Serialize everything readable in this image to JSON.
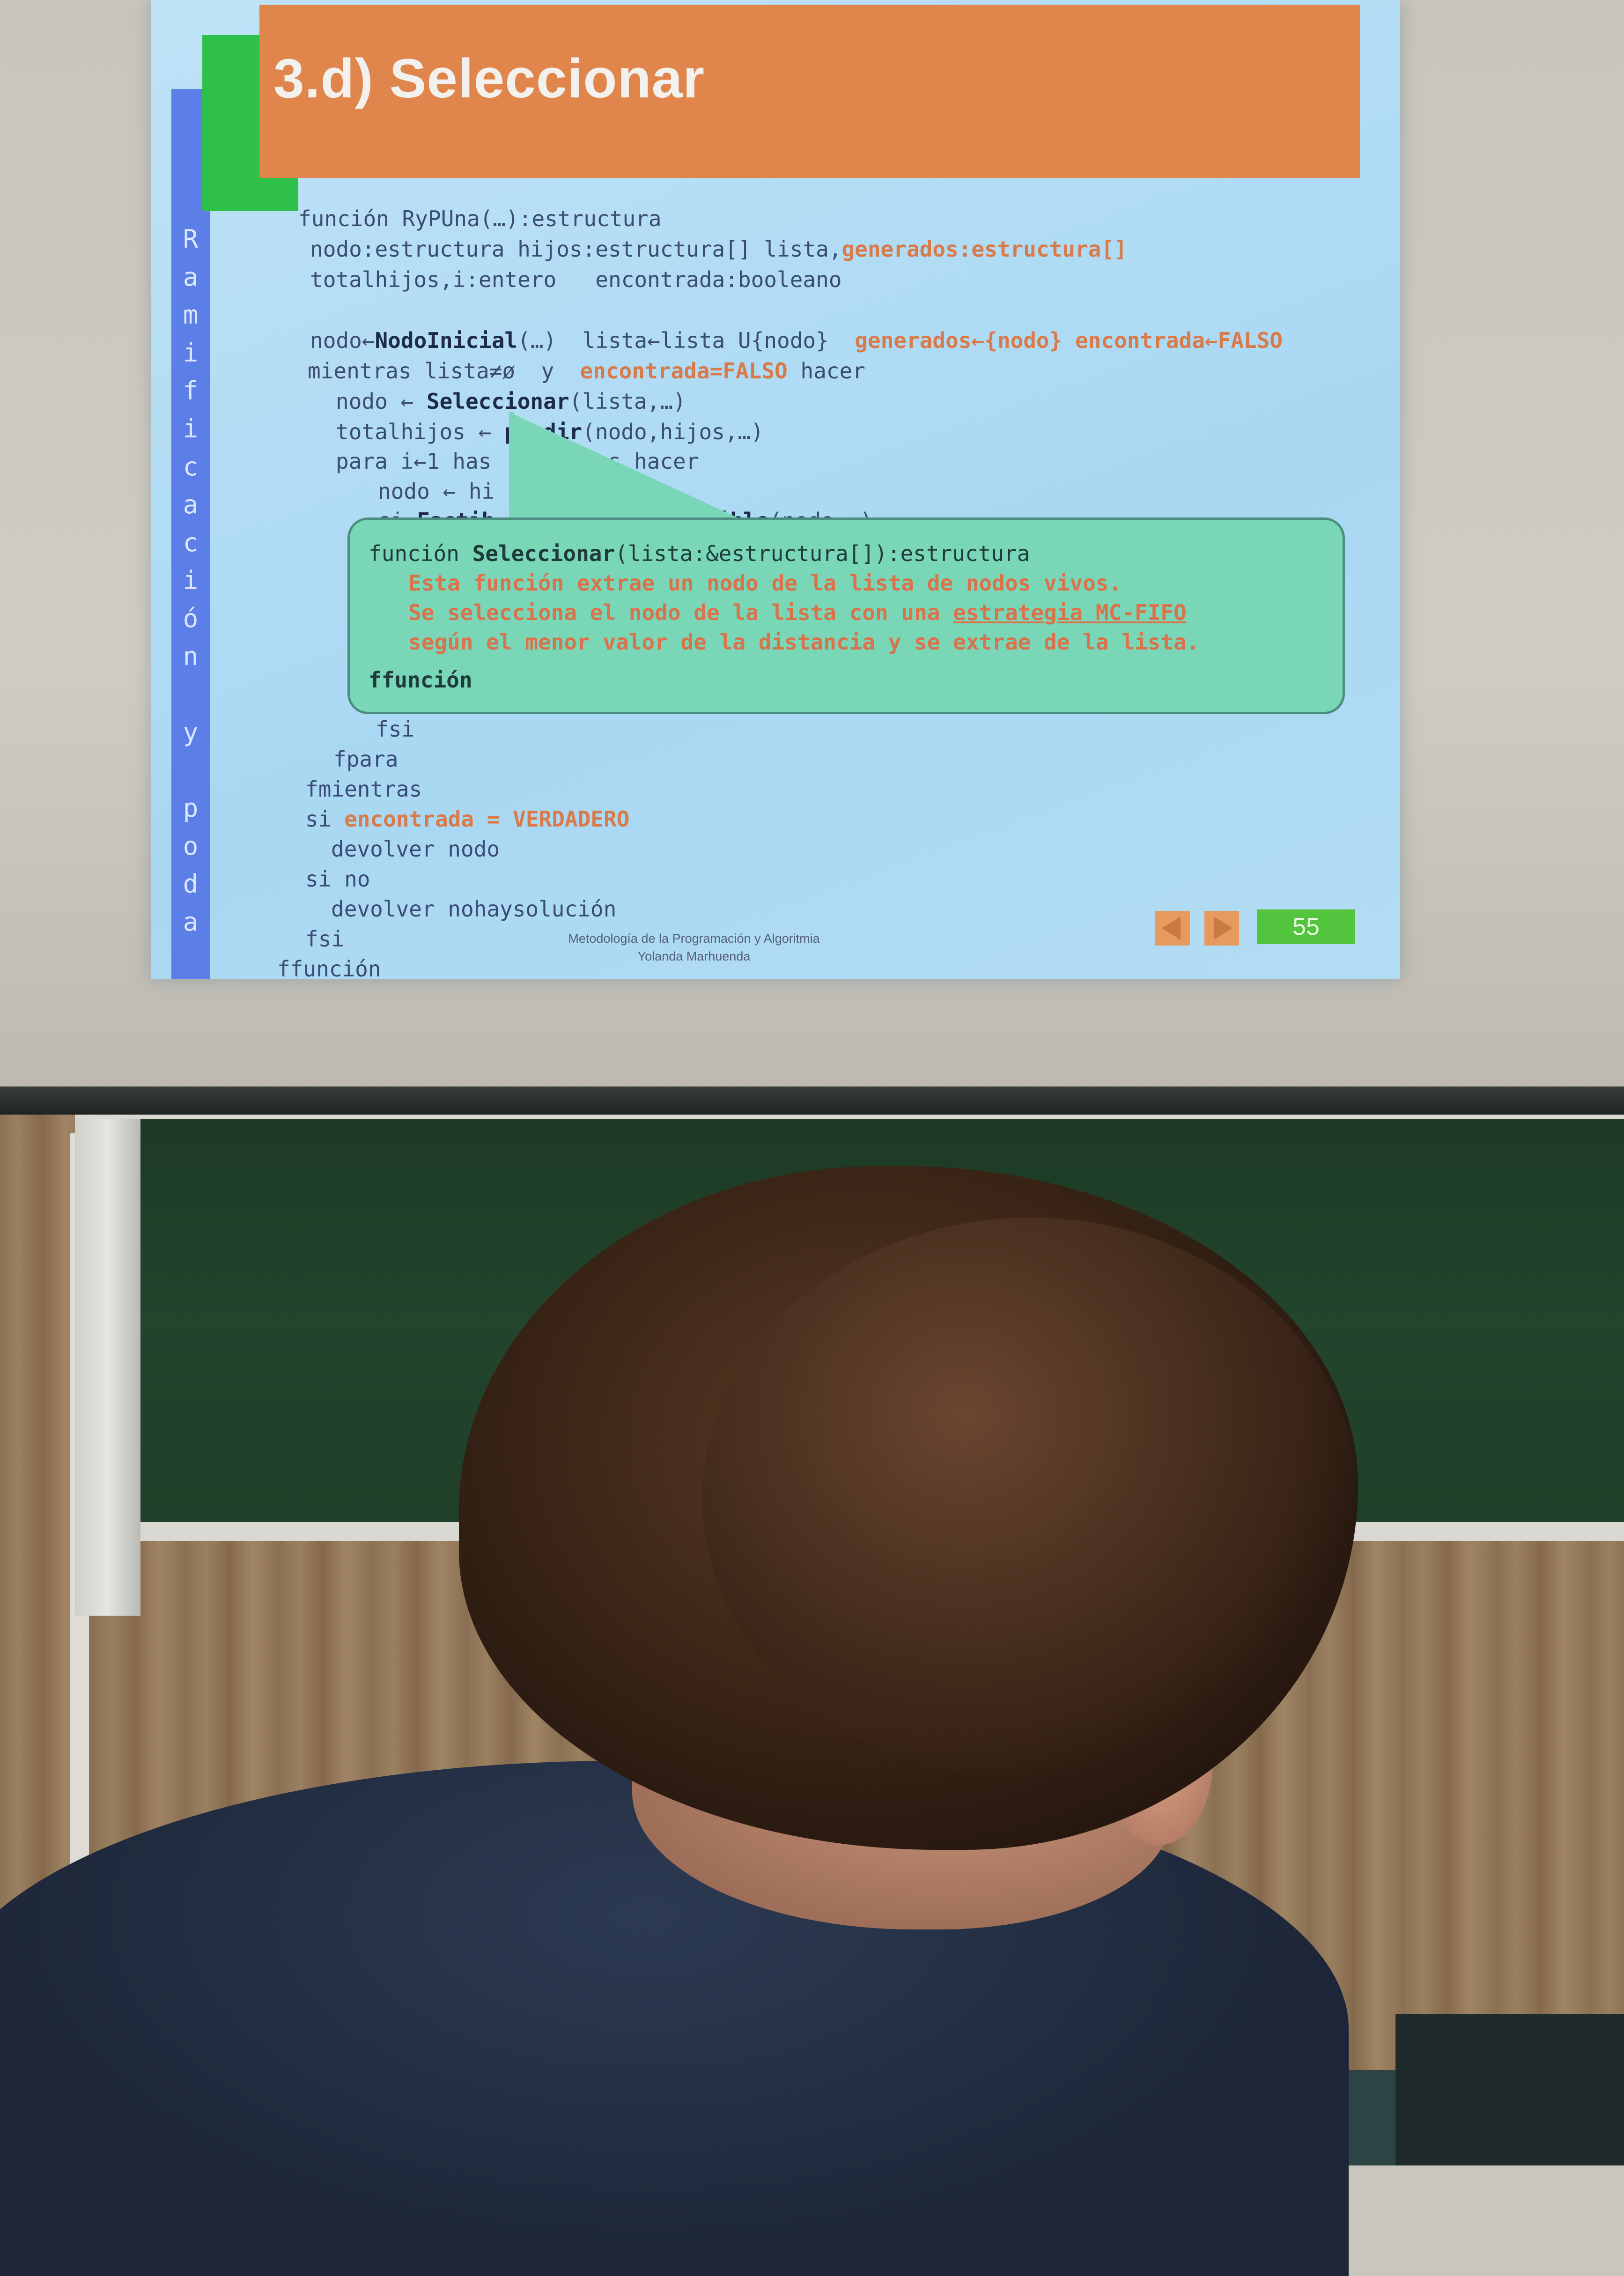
{
  "slide": {
    "title": "3.d) Seleccionar",
    "side_vertical_text": "R\na\nm\ni\nf\ni\nc\na\nc\ni\nó\nn\n\ny\n\np\no\nd\na",
    "code": {
      "l1": "función RyPUna(…):estructura",
      "l2a": "nodo:estructura hijos:estructura[] lista,",
      "l2b": "generados:estructura[]",
      "l3": "totalhijos,i:entero   encontrada:booleano",
      "l4a": "nodo←",
      "l4b": "NodoInicial",
      "l4c": "(…)  lista←lista U{nodo}  ",
      "l4d": "generados←{nodo} encontrada←FALSO",
      "l5a": "mientras lista≠ø  y  ",
      "l5b": "encontrada=FALSO",
      "l5c": " hacer",
      "l6a": "nodo ← ",
      "l6b": "Seleccionar",
      "l6c": "(lista,…)",
      "l7a": "totalhijos ← ",
      "l7b": "pandir",
      "l7c": "(nodo,hijos,…)",
      "l8": "para i←1 has    lhijos hacer",
      "l9": "nodo ← hi",
      "l10a": "si ",
      "l10b": "Factib",
      "l10c": "isible",
      "l10d": "(nodo,…)",
      "l11": "fsi",
      "l12": "fpara",
      "l13": "fmientras",
      "l14a": "si ",
      "l14b": "encontrada = VERDADERO",
      "l15": "devolver nodo",
      "l16": "si no",
      "l17": "devolver nohaysolución",
      "l18": "fsi",
      "l19": "ffunción"
    },
    "callout": {
      "c1a": "función ",
      "c1b": "Seleccionar",
      "c1c": "(lista:&estructura[]):estructura",
      "c2": "Esta función extrae un nodo de la lista de nodos vivos.",
      "c3a": "Se selecciona el nodo de la lista con una ",
      "c3b": "estrategia MC-FIFO",
      "c4": "según el menor valor de la distancia y se extrae de la lista.",
      "c5": "ffunción"
    },
    "footer": {
      "course": "Metodología de la Programación y Algoritmia",
      "author": "Yolanda Marhuenda"
    },
    "page_number": "55",
    "colors": {
      "title_bar": "#e0864c",
      "side_bar": "#5b7fe6",
      "accent_green": "#2fc04a",
      "callout": "#79d7b8",
      "highlight": "#d97a4a"
    }
  },
  "icons": {
    "prev": "triangle-left-icon",
    "next": "triangle-right-icon"
  }
}
